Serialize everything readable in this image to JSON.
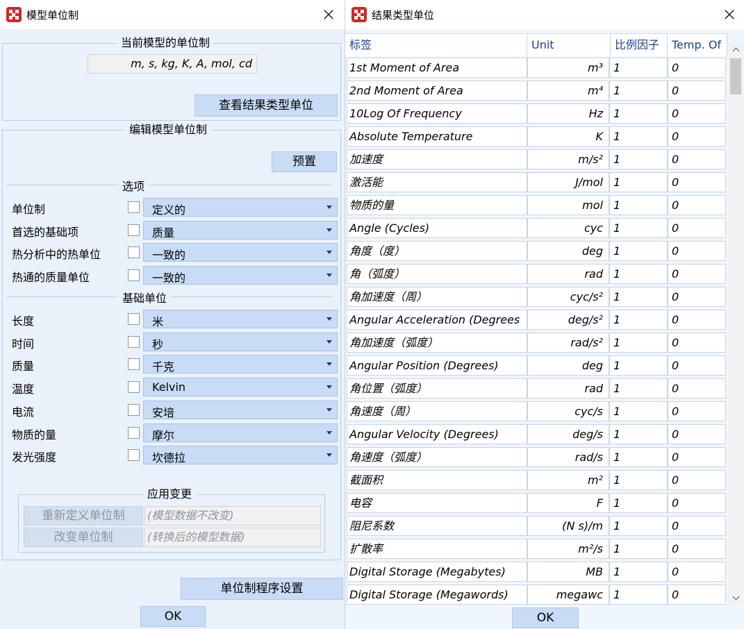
{
  "model_dialog": {
    "title": "模型单位制",
    "current_section": {
      "legend": "当前模型的单位制",
      "units_display": "m, s, kg, K, A, mol, cd",
      "view_button": "查看结果类型单位"
    },
    "edit_section": {
      "legend": "编辑模型单位制",
      "preset_button": "预置",
      "options_header": "选项",
      "options": [
        {
          "label": "单位制",
          "value": "定义的",
          "checked": false
        },
        {
          "label": "首选的基础项",
          "value": "质量",
          "checked": false
        },
        {
          "label": "热分析中的热单位",
          "value": "一致的",
          "checked": false
        },
        {
          "label": "热通的质量单位",
          "value": "一致的",
          "checked": false
        }
      ],
      "base_header": "基础单位",
      "base_units": [
        {
          "label": "长度",
          "value": "米",
          "checked": false
        },
        {
          "label": "时间",
          "value": "秒",
          "checked": false
        },
        {
          "label": "质量",
          "value": "千克",
          "checked": false
        },
        {
          "label": "温度",
          "value": "Kelvin",
          "checked": false
        },
        {
          "label": "电流",
          "value": "安培",
          "checked": false
        },
        {
          "label": "物质的量",
          "value": "摩尔",
          "checked": false
        },
        {
          "label": "发光强度",
          "value": "坎德拉",
          "checked": false
        }
      ],
      "apply_section": {
        "legend": "应用变更",
        "redefine_button": "重新定义单位制",
        "redefine_note": "(模型数据不改变)",
        "change_button": "改变单位制",
        "change_note": "(转换后的模型数据)"
      }
    },
    "program_settings_button": "单位制程序设置",
    "ok_button": "OK"
  },
  "result_dialog": {
    "title": "结果类型单位",
    "columns": [
      "标签",
      "Unit",
      "比例因子",
      "Temp. Of"
    ],
    "rows": [
      {
        "label": "1st Moment of Area",
        "unit": "m³",
        "scale": "1",
        "offset": "0"
      },
      {
        "label": "2nd Moment of Area",
        "unit": "m⁴",
        "scale": "1",
        "offset": "0"
      },
      {
        "label": "10Log Of Frequency",
        "unit": "Hz",
        "scale": "1",
        "offset": "0"
      },
      {
        "label": "Absolute Temperature",
        "unit": "K",
        "scale": "1",
        "offset": "0"
      },
      {
        "label": "加速度",
        "unit": "m/s²",
        "scale": "1",
        "offset": "0"
      },
      {
        "label": "激活能",
        "unit": "J/mol",
        "scale": "1",
        "offset": "0"
      },
      {
        "label": "物质的量",
        "unit": "mol",
        "scale": "1",
        "offset": "0"
      },
      {
        "label": "Angle (Cycles)",
        "unit": "cyc",
        "scale": "1",
        "offset": "0"
      },
      {
        "label": "角度（度）",
        "unit": "deg",
        "scale": "1",
        "offset": "0"
      },
      {
        "label": "角（弧度）",
        "unit": "rad",
        "scale": "1",
        "offset": "0"
      },
      {
        "label": "角加速度（周）",
        "unit": "cyc/s²",
        "scale": "1",
        "offset": "0"
      },
      {
        "label": "Angular Acceleration (Degrees",
        "unit": "deg/s²",
        "scale": "1",
        "offset": "0"
      },
      {
        "label": "角加速度（弧度）",
        "unit": "rad/s²",
        "scale": "1",
        "offset": "0"
      },
      {
        "label": "Angular Position (Degrees)",
        "unit": "deg",
        "scale": "1",
        "offset": "0"
      },
      {
        "label": "角位置（弧度）",
        "unit": "rad",
        "scale": "1",
        "offset": "0"
      },
      {
        "label": "角速度（周）",
        "unit": "cyc/s",
        "scale": "1",
        "offset": "0"
      },
      {
        "label": "Angular Velocity (Degrees)",
        "unit": "deg/s",
        "scale": "1",
        "offset": "0"
      },
      {
        "label": "角速度（弧度）",
        "unit": "rad/s",
        "scale": "1",
        "offset": "0"
      },
      {
        "label": "截面积",
        "unit": "m²",
        "scale": "1",
        "offset": "0"
      },
      {
        "label": "电容",
        "unit": "F",
        "scale": "1",
        "offset": "0"
      },
      {
        "label": "阻尼系数",
        "unit": "(N s)/m",
        "scale": "1",
        "offset": "0"
      },
      {
        "label": "扩散率",
        "unit": "m²/s",
        "scale": "1",
        "offset": "0"
      },
      {
        "label": "Digital Storage (Megabytes)",
        "unit": "MB",
        "scale": "1",
        "offset": "0"
      },
      {
        "label": "Digital Storage (Megawords)",
        "unit": "megawc",
        "scale": "1",
        "offset": "0"
      }
    ],
    "ok_button": "OK"
  },
  "icons": {
    "app": "app-logo-icon",
    "close": "close-icon",
    "dropdown": "chevron-down-icon"
  },
  "colors": {
    "button": "#c8dcf5",
    "dialog_bg": "#e9f1fb",
    "header_text": "#1f3e8b",
    "app_icon": "#d9242a"
  }
}
